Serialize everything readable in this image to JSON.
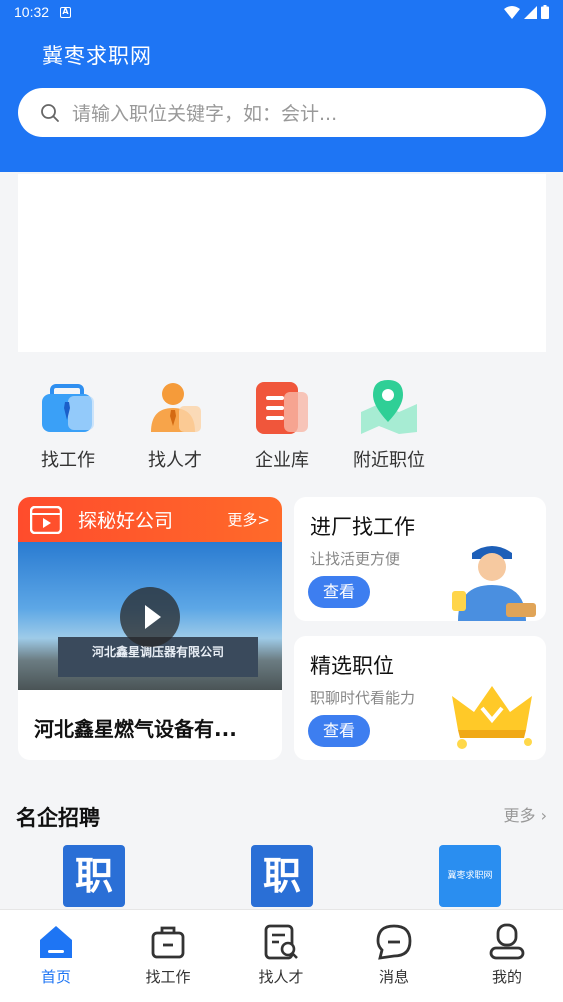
{
  "status": {
    "time": "10:32",
    "notif": "A"
  },
  "app": {
    "title": "冀枣求职网"
  },
  "search": {
    "placeholder": "请输入职位关键字，如：会计..."
  },
  "menu": [
    {
      "label": "找工作",
      "icon": "briefcase-icon"
    },
    {
      "label": "找人才",
      "icon": "person-icon"
    },
    {
      "label": "企业库",
      "icon": "building-icon"
    },
    {
      "label": "附近职位",
      "icon": "location-icon"
    }
  ],
  "explore": {
    "title": "探秘好公司",
    "more": "更多>",
    "sign": "河北鑫星调压器有限公司",
    "company": "河北鑫星燃气设备有..."
  },
  "cards": [
    {
      "title": "进厂找工作",
      "sub": "让找活更方便",
      "btn": "查看"
    },
    {
      "title": "精选职位",
      "sub": "职聊时代看能力",
      "btn": "查看"
    }
  ],
  "section": {
    "title": "名企招聘",
    "more": "更多",
    "logos": [
      "职",
      "职",
      "冀枣求职网"
    ]
  },
  "tabs": [
    {
      "label": "首页",
      "active": true
    },
    {
      "label": "找工作"
    },
    {
      "label": "找人才"
    },
    {
      "label": "消息"
    },
    {
      "label": "我的"
    }
  ],
  "colors": {
    "primary": "#1e75f4",
    "accent": "#ff5a2c"
  }
}
